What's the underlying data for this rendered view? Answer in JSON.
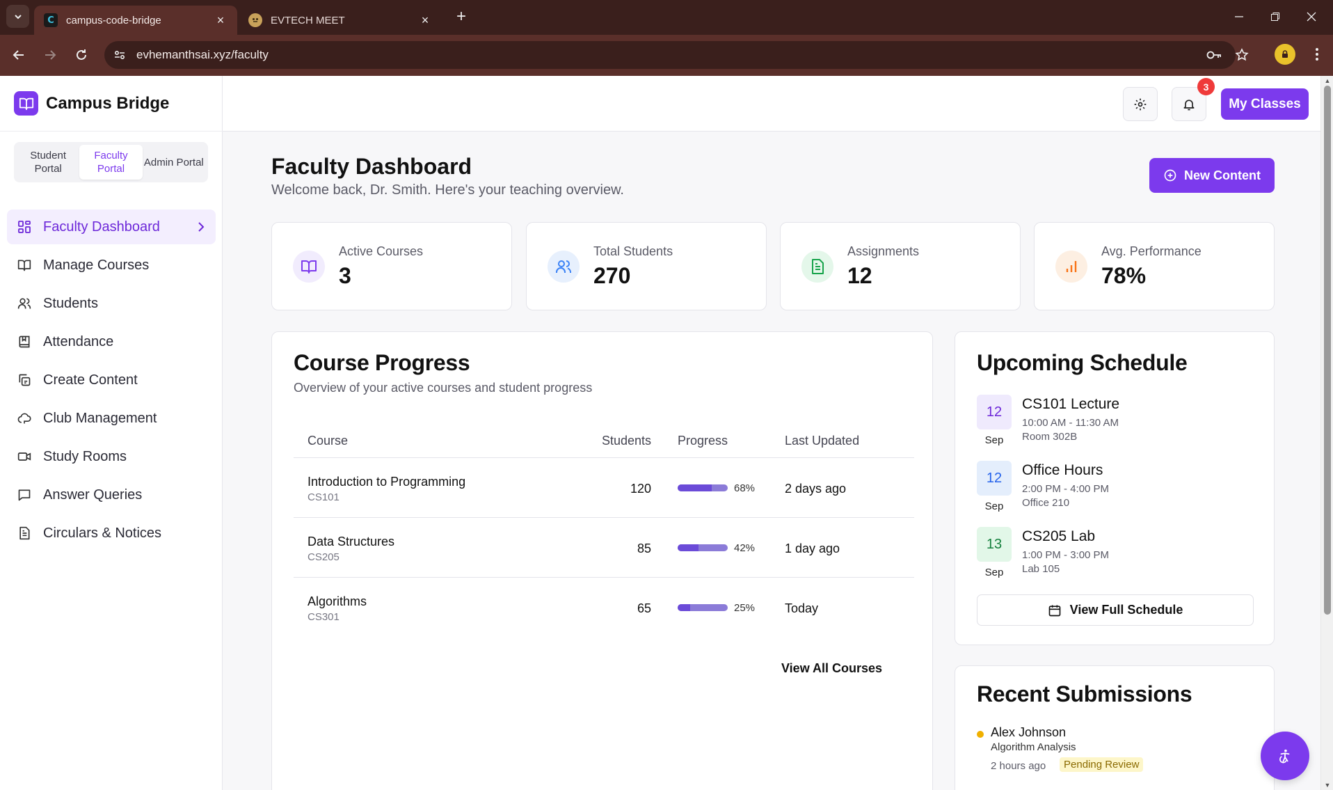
{
  "browser": {
    "tabs": [
      {
        "title": "campus-code-bridge",
        "favicon": "C"
      },
      {
        "title": "EVTECH MEET"
      }
    ],
    "url": "evhemanthsai.xyz/faculty"
  },
  "brand": {
    "name": "Campus Bridge",
    "accent": "#7c3aed"
  },
  "portals": [
    {
      "label": "Student Portal"
    },
    {
      "label": "Faculty Portal",
      "selected": true
    },
    {
      "label": "Admin Portal"
    }
  ],
  "nav": [
    {
      "label": "Faculty Dashboard",
      "icon": "grid-icon",
      "selected": true
    },
    {
      "label": "Manage Courses",
      "icon": "book-icon"
    },
    {
      "label": "Students",
      "icon": "users-icon"
    },
    {
      "label": "Attendance",
      "icon": "bookmark-book-icon"
    },
    {
      "label": "Create Content",
      "icon": "copy-icon"
    },
    {
      "label": "Club Management",
      "icon": "cloud-icon"
    },
    {
      "label": "Study Rooms",
      "icon": "video-icon"
    },
    {
      "label": "Answer Queries",
      "icon": "message-icon"
    },
    {
      "label": "Circulars & Notices",
      "icon": "file-text-icon"
    }
  ],
  "topbar": {
    "notifications_count": "3",
    "my_classes_label": "My Classes"
  },
  "header": {
    "title": "Faculty Dashboard",
    "subtitle": "Welcome back, Dr. Smith. Here's your teaching overview.",
    "new_content_label": "New Content"
  },
  "stats": [
    {
      "label": "Active Courses",
      "value": "3",
      "icon": "book-icon",
      "color": "#7c3aed"
    },
    {
      "label": "Total Students",
      "value": "270",
      "icon": "users-icon",
      "color": "#3b82f6"
    },
    {
      "label": "Assignments",
      "value": "12",
      "icon": "file-text-icon",
      "color": "#16a34a"
    },
    {
      "label": "Avg. Performance",
      "value": "78%",
      "icon": "bar-chart-icon",
      "color": "#f97316"
    }
  ],
  "course_progress": {
    "title": "Course Progress",
    "subtitle": "Overview of your active courses and student progress",
    "columns": [
      "Course",
      "Students",
      "Progress",
      "Last Updated"
    ],
    "rows": [
      {
        "name": "Introduction to Programming",
        "code": "CS101",
        "students": "120",
        "progress": 68,
        "progress_label": "68%",
        "updated": "2 days ago"
      },
      {
        "name": "Data Structures",
        "code": "CS205",
        "students": "85",
        "progress": 42,
        "progress_label": "42%",
        "updated": "1 day ago"
      },
      {
        "name": "Algorithms",
        "code": "CS301",
        "students": "65",
        "progress": 25,
        "progress_label": "25%",
        "updated": "Today"
      }
    ],
    "view_all_label": "View All Courses"
  },
  "schedule": {
    "title": "Upcoming Schedule",
    "items": [
      {
        "day": "12",
        "month": "Sep",
        "title": "CS101 Lecture",
        "time": "10:00 AM - 11:30 AM",
        "room": "Room 302B",
        "bg": "#efeafd",
        "fg": "#6d28d9"
      },
      {
        "day": "12",
        "month": "Sep",
        "title": "Office Hours",
        "time": "2:00 PM - 4:00 PM",
        "room": "Office 210",
        "bg": "#e4eefc",
        "fg": "#2563eb"
      },
      {
        "day": "13",
        "month": "Sep",
        "title": "CS205 Lab",
        "time": "1:00 PM - 3:00 PM",
        "room": "Lab 105",
        "bg": "#e2f7e8",
        "fg": "#15803d"
      }
    ],
    "view_full_label": "View Full Schedule"
  },
  "submissions": {
    "title": "Recent Submissions",
    "items": [
      {
        "name": "Alex Johnson",
        "work": "Algorithm Analysis",
        "when": "2 hours ago",
        "status": "Pending Review"
      }
    ]
  }
}
